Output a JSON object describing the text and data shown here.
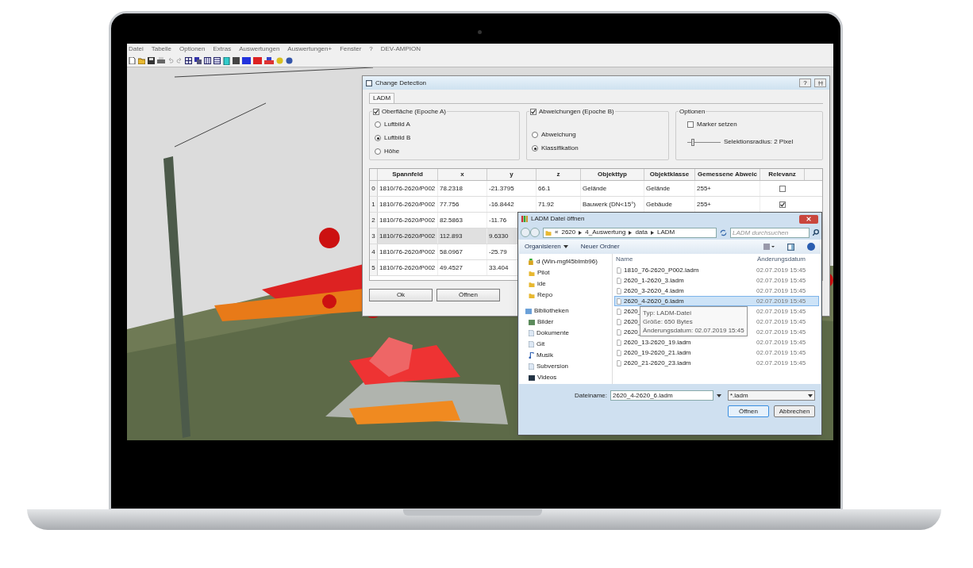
{
  "menu": [
    "Datei",
    "Tabelle",
    "Optionen",
    "Extras",
    "Auswertungen",
    "Auswertungen+",
    "Fenster",
    "?",
    "DEV-AMPION"
  ],
  "change_detection": {
    "title": "Change Detection",
    "help": "?",
    "tabs": [
      {
        "label": "LADM",
        "selected": true
      }
    ],
    "group_a": {
      "label": "Oberfläche (Epoche A)",
      "checked": true,
      "options": [
        {
          "label": "Luftbild A",
          "selected": false
        },
        {
          "label": "Luftbild B",
          "selected": true
        },
        {
          "label": "Höhe",
          "selected": false
        }
      ]
    },
    "group_b": {
      "label": "Abweichungen (Epoche B)",
      "checked": true,
      "options": [
        {
          "label": "Abweichung",
          "selected": false
        },
        {
          "label": "Klassifikation",
          "selected": true
        }
      ]
    },
    "options": {
      "title": "Optionen",
      "marker": {
        "label": "Marker setzen",
        "checked": false
      },
      "slider": {
        "level": 0.12,
        "label": "Selektionsradius: 2 Pixel"
      }
    },
    "table": {
      "columns": [
        "Spannfeld",
        "x",
        "y",
        "z",
        "Objekttyp",
        "Objektklasse",
        "Gemessene Abweic",
        "Relevanz"
      ],
      "rows": [
        {
          "index": "0",
          "selected": false,
          "cells": [
            "1810/76-2620/P002",
            "78.2318",
            "-21.3795",
            "66.1",
            "Gelände",
            "Gelände",
            "255+"
          ],
          "relevant": false
        },
        {
          "index": "1",
          "selected": false,
          "cells": [
            "1810/76-2620/P002",
            "77.756",
            "-16.8442",
            "71.92",
            "Bauwerk (DN<15°)",
            "Gebäude",
            "255+"
          ],
          "relevant": true
        },
        {
          "index": "2",
          "selected": false,
          "cells": [
            "1810/76-2620/P002",
            "82.5863",
            "-11.76"
          ]
        },
        {
          "index": "3",
          "selected": true,
          "cells": [
            "1810/76-2620/P002",
            "112.893",
            "9.6330"
          ]
        },
        {
          "index": "4",
          "selected": false,
          "cells": [
            "1810/76-2620/P002",
            "58.0967",
            "-25.79"
          ]
        },
        {
          "index": "5",
          "selected": false,
          "cells": [
            "1810/76-2620/P002",
            "49.4527",
            "33.404"
          ]
        }
      ]
    },
    "buttons": [
      "Ok",
      "Öffnen"
    ]
  },
  "file_dialog": {
    "title": "LADM Datei öffnen",
    "path": [
      "«",
      "2620",
      "4_Auswertung",
      "data",
      "LADM"
    ],
    "search_placeholder": "LADM durchsuchen",
    "toolbar": [
      {
        "label": "Organisieren",
        "kind": "menu"
      },
      {
        "label": "Neuer Ordner",
        "kind": "plain"
      }
    ],
    "nav": [
      {
        "label": "d (Win-mgf45blmb96)",
        "kind": "drive"
      },
      {
        "label": "Pilot",
        "kind": "folder"
      },
      {
        "label": "ide",
        "kind": "folder"
      },
      {
        "label": "Repo",
        "kind": "folder"
      },
      {
        "label": "Bibliotheken",
        "kind": "library"
      },
      {
        "label": "Bilder",
        "kind": "pictures"
      },
      {
        "label": "Dokumente",
        "kind": "documents"
      },
      {
        "label": "Git",
        "kind": "documents"
      },
      {
        "label": "Musik",
        "kind": "music"
      },
      {
        "label": "Subversion",
        "kind": "documents"
      },
      {
        "label": "Videos",
        "kind": "videos"
      }
    ],
    "columns": [
      "Name",
      "Änderungsdatum"
    ],
    "files": [
      {
        "name": "1810_76-2620_P002.ladm",
        "date": "02.07.2019 15:45",
        "selected": false
      },
      {
        "name": "2620_1-2620_3.ladm",
        "date": "02.07.2019 15:45",
        "selected": false
      },
      {
        "name": "2620_3-2620_4.ladm",
        "date": "02.07.2019 15:45",
        "selected": false
      },
      {
        "name": "2620_4-2620_6.ladm",
        "date": "02.07.2019 15:45",
        "selected": true
      },
      {
        "name": "2620_",
        "date": "02.07.2019 15:45",
        "selected": false
      },
      {
        "name": "2620_",
        "date": "02.07.2019 15:45",
        "selected": false
      },
      {
        "name": "2620_",
        "date": "02.07.2019 15:45",
        "selected": false
      },
      {
        "name": "2620_13-2620_19.ladm",
        "date": "02.07.2019 15:45",
        "selected": false
      },
      {
        "name": "2620_19-2620_21.ladm",
        "date": "02.07.2019 15:45",
        "selected": false
      },
      {
        "name": "2620_21-2620_23.ladm",
        "date": "02.07.2019 15:45",
        "selected": false
      }
    ],
    "tooltip": [
      "Typ: LADM-Datei",
      "Größe: 650 Bytes",
      "Änderungsdatum: 02.07.2019 15:45"
    ],
    "filename_label": "Dateiname:",
    "filename": "2620_4-2620_6.ladm",
    "filter": "*.ladm",
    "buttons": [
      {
        "label": "Öffnen",
        "kind": "primary"
      },
      {
        "label": "Abbrechen",
        "kind": "normal"
      }
    ]
  }
}
